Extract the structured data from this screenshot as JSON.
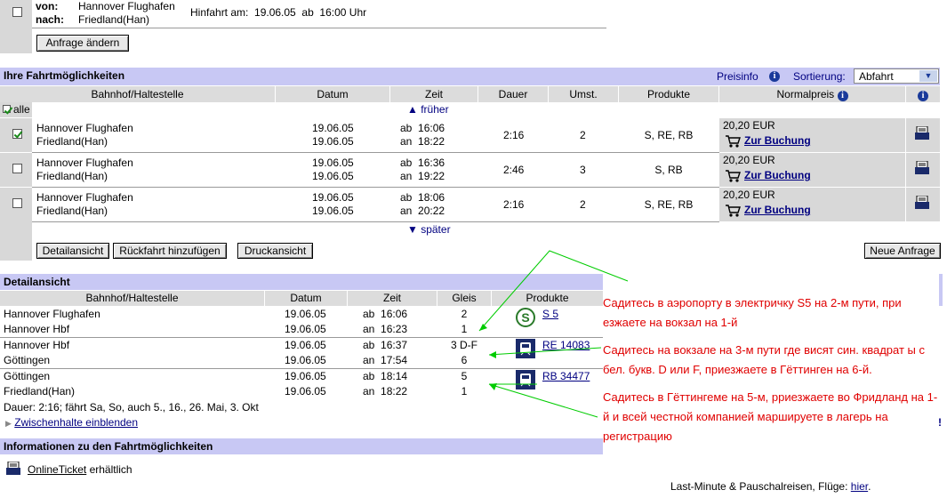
{
  "search": {
    "from_label": "von:",
    "to_label": "nach:",
    "from_value": "Hannover Flughafen",
    "to_value": "Friedland(Han)",
    "departure_text": "Hinfahrt am:  19.06.05  ab  16:00 Uhr",
    "change_button": "Anfrage ändern"
  },
  "connections": {
    "title": "Ihre Fahrtmöglichkeiten",
    "price_info": "Preisinfo",
    "sort_label": "Sortierung:",
    "sort_value": "Abfahrt",
    "columns": [
      "Bahnhof/Haltestelle",
      "Datum",
      "Zeit",
      "Dauer",
      "Umst.",
      "Produkte",
      "Normalpreis"
    ],
    "all_label": "alle",
    "earlier": "▲ früher",
    "later": "▼ später",
    "rows": [
      {
        "from": "Hannover Flughafen",
        "to": "Friedland(Han)",
        "date1": "19.06.05",
        "date2": "19.06.05",
        "dep": "ab  16:06",
        "arr": "an  18:22",
        "duration": "2:16",
        "changes": "2",
        "products": "S, RE, RB",
        "price": "20,20 EUR",
        "book": "Zur Buchung",
        "checked": true
      },
      {
        "from": "Hannover Flughafen",
        "to": "Friedland(Han)",
        "date1": "19.06.05",
        "date2": "19.06.05",
        "dep": "ab  16:36",
        "arr": "an  19:22",
        "duration": "2:46",
        "changes": "3",
        "products": "S, RB",
        "price": "20,20 EUR",
        "book": "Zur Buchung",
        "checked": false
      },
      {
        "from": "Hannover Flughafen",
        "to": "Friedland(Han)",
        "date1": "19.06.05",
        "date2": "19.06.05",
        "dep": "ab  18:06",
        "arr": "an  20:22",
        "duration": "2:16",
        "changes": "2",
        "products": "S, RE, RB",
        "price": "20,20 EUR",
        "book": "Zur Buchung",
        "checked": false
      }
    ],
    "buttons": {
      "detail": "Detailansicht",
      "return": "Rückfahrt hinzufügen",
      "print": "Druckansicht",
      "new": "Neue Anfrage"
    }
  },
  "detail": {
    "title": "Detailansicht",
    "columns": [
      "Bahnhof/Haltestelle",
      "Datum",
      "Zeit",
      "Gleis",
      "Produkte"
    ],
    "legs": [
      {
        "from": "Hannover Flughafen",
        "to": "Hannover Hbf",
        "d1": "19.06.05",
        "d2": "19.06.05",
        "dep": "ab  16:06",
        "arr": "an  16:23",
        "g1": "2",
        "g2": "1",
        "train": "S 5",
        "icon": "s-bahn-icon"
      },
      {
        "from": "Hannover Hbf",
        "to": "Göttingen",
        "d1": "19.06.05",
        "d2": "19.06.05",
        "dep": "ab  16:37",
        "arr": "an  17:54",
        "g1": "3 D-F",
        "g2": "6",
        "train": "RE 14083",
        "icon": "train-icon"
      },
      {
        "from": "Göttingen",
        "to": "Friedland(Han)",
        "d1": "19.06.05",
        "d2": "19.06.05",
        "dep": "ab  18:14",
        "arr": "an  18:22",
        "g1": "5",
        "g2": "1",
        "train": "RB 34477",
        "icon": "train-icon"
      }
    ],
    "duration_text": "Dauer: 2:16; fährt Sa, So, auch 5., 16., 26. Mai, 3. Okt",
    "stops_link": "Zwischenhalte einblenden"
  },
  "info": {
    "title": "Informationen zu den Fahrtmöglichkeiten",
    "ticket_link": "OnlineTicket",
    "ticket_suffix": " erhältlich",
    "footer_text": "Last-Minute & Pauschalreisen, Flüge: ",
    "footer_link": "hier",
    "footer_end": "."
  },
  "annotations": {
    "note1": "Садитесь в аэропорту в электричку S5 на 2-м пути, при езжаете на вокзал на 1-й",
    "note2": "Садитесь на вокзале на 3-м пути где висят син. квадрат ы с бел. букв. D или F, приезжаете в Гёттинген на 6-й.",
    "note3": "Садитесь в Гёттингеме на 5-м, рриезжаете во Фридланд на 1-й и всей честной компанией маршируете в лагерь на регистрацию",
    "exclam": "!",
    "color": "#e00000",
    "arrow_color": "#00cc00"
  }
}
